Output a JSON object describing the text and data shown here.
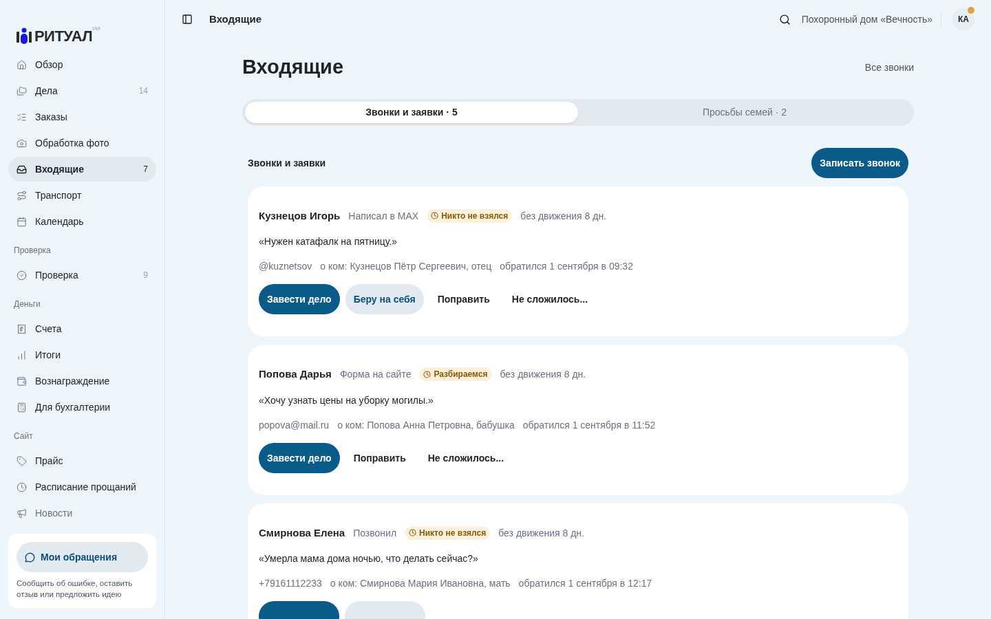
{
  "logo": {
    "name": "РИТУАЛ",
    "mark": "ИИ"
  },
  "sidebar": {
    "sections": [
      {
        "items": [
          {
            "label": "Обзор",
            "selected": false,
            "disabled": false
          },
          {
            "label": "Дела",
            "count": "14",
            "selected": false,
            "disabled": false
          },
          {
            "label": "Заказы",
            "selected": false,
            "disabled": false
          },
          {
            "label": "Обработка фото",
            "selected": false,
            "disabled": false
          },
          {
            "label": "Входящие",
            "count": "7",
            "selected": true,
            "disabled": false
          },
          {
            "label": "Транспорт",
            "selected": false,
            "disabled": false
          },
          {
            "label": "Календарь",
            "selected": false,
            "disabled": false
          }
        ]
      },
      {
        "heading": "Проверка",
        "items": [
          {
            "label": "Проверка",
            "count": "9",
            "selected": false,
            "disabled": false
          }
        ]
      },
      {
        "heading": "Деньги",
        "items": [
          {
            "label": "Счета",
            "selected": false,
            "disabled": false
          },
          {
            "label": "Итоги",
            "selected": false,
            "disabled": false
          },
          {
            "label": "Вознаграждение",
            "selected": false,
            "disabled": false
          },
          {
            "label": "Для бухгалтерии",
            "selected": false,
            "disabled": false
          }
        ]
      },
      {
        "heading": "Сайт",
        "items": [
          {
            "label": "Прайс",
            "selected": false,
            "disabled": false
          },
          {
            "label": "Расписание прощаний",
            "selected": false,
            "disabled": false
          },
          {
            "label": "Новости",
            "selected": false,
            "disabled": true
          }
        ]
      }
    ],
    "feedback": {
      "button": "Мои обращения",
      "text": "Сообщить об ошибке, оставить отзыв или предложить идею"
    }
  },
  "header": {
    "title": "Входящие",
    "organization": "Похоронный дом «Вечность»",
    "avatar": "КА",
    "notification": true
  },
  "page": {
    "title": "Входящие",
    "link": "Все звонки",
    "tabs": [
      {
        "label": "Звонки и заявки · 5",
        "selected": true
      },
      {
        "label": "Просьбы семей · 2",
        "selected": false
      }
    ],
    "section_title": "Звонки и заявки",
    "record_button": "Записать звонок",
    "cards": [
      {
        "name": "Кузнецов Игорь",
        "channel": "Написал в MAX",
        "status": "Никто не взялся",
        "idle": "без движения 8 дн.",
        "message": "«Нужен катафалк на пятницу.»",
        "contact": "@kuznetsov",
        "about": "о ком: Кузнецов Пётр Сергеевич, отец",
        "date": "обратился 1 сентября в 09:32",
        "actions": [
          {
            "kind": "primary",
            "label": "Завести дело"
          },
          {
            "kind": "secondary",
            "label": "Беру на себя"
          },
          {
            "kind": "plain",
            "label": "Поправить"
          },
          {
            "kind": "plain",
            "label": "Не сложилось..."
          }
        ]
      },
      {
        "name": "Попова Дарья",
        "channel": "Форма на сайте",
        "status": "Разбираемся",
        "idle": "без движения 8 дн.",
        "message": "«Хочу узнать цены на уборку могилы.»",
        "contact": "popova@mail.ru",
        "about": "о ком: Попова Анна Петровна, бабушка",
        "date": "обратился 1 сентября в 11:52",
        "actions": [
          {
            "kind": "primary",
            "label": "Завести дело"
          },
          {
            "kind": "plain",
            "label": "Поправить"
          },
          {
            "kind": "plain",
            "label": "Не сложилось..."
          }
        ]
      },
      {
        "name": "Смирнова Елена",
        "channel": "Позвонил",
        "status": "Никто не взялся",
        "idle": "без движения 8 дн.",
        "message": "«Умерла мама дома ночью, что делать сейчас?»",
        "contact": "+79161112233",
        "about": "о ком: Смирнова Мария Ивановна, мать",
        "date": "обратился 1 сентября в 12:17",
        "actions": [
          {
            "kind": "primary"
          },
          {
            "kind": "secondary"
          }
        ]
      }
    ]
  }
}
